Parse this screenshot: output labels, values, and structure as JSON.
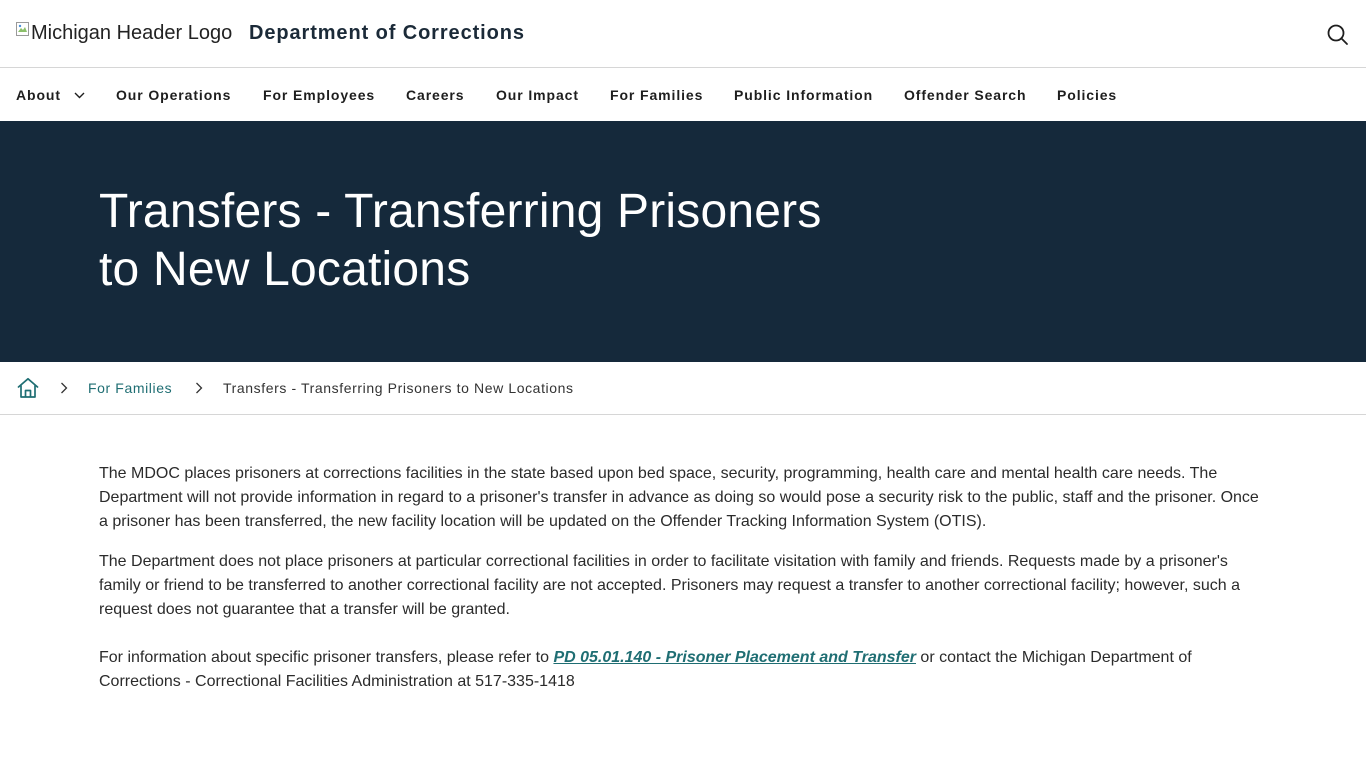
{
  "header": {
    "logo_alt": "Michigan Header Logo",
    "title": "Department of Corrections",
    "search_icon": "search-icon"
  },
  "nav": {
    "items": [
      {
        "label": "About",
        "has_dropdown": true
      },
      {
        "label": "Our Operations"
      },
      {
        "label": "For Employees"
      },
      {
        "label": "Careers"
      },
      {
        "label": "Our Impact"
      },
      {
        "label": "For Families"
      },
      {
        "label": "Public Information"
      },
      {
        "label": "Offender Search"
      },
      {
        "label": "Policies"
      }
    ]
  },
  "hero": {
    "title": "Transfers - Transferring Prisoners to New Locations"
  },
  "breadcrumb": {
    "home_icon": "home-icon",
    "parent": "For Families",
    "current": "Transfers - Transferring Prisoners to New Locations"
  },
  "content": {
    "p1": "The MDOC places prisoners at corrections facilities in the state based upon bed space, security, programming, health care and mental health care needs.  The Department will not provide information in regard to a prisoner's transfer in advance as doing so would pose a security risk to the public, staff and the prisoner.  Once a prisoner has been transferred, the new facility location will be updated on the Offender Tracking Information System (OTIS).",
    "p2": "The Department does not place prisoners at particular correctional facilities in order to facilitate visitation with family and friends.  Requests made by a prisoner's family or friend to be transferred to another correctional facility are not accepted.  Prisoners may request a transfer to another correctional facility; however, such a request does not guarantee that a transfer will be granted.",
    "p3_before": "For information about specific prisoner transfers, please refer to ",
    "p3_link": "PD 05.01.140 - Prisoner Placement and Transfer",
    "p3_after": " or contact the Michigan Department of Corrections - Correctional Facilities Administration at 517-335-1418"
  },
  "colors": {
    "hero_bg": "#15293b",
    "link": "#1f6e73",
    "header_title": "#1b2a38"
  }
}
